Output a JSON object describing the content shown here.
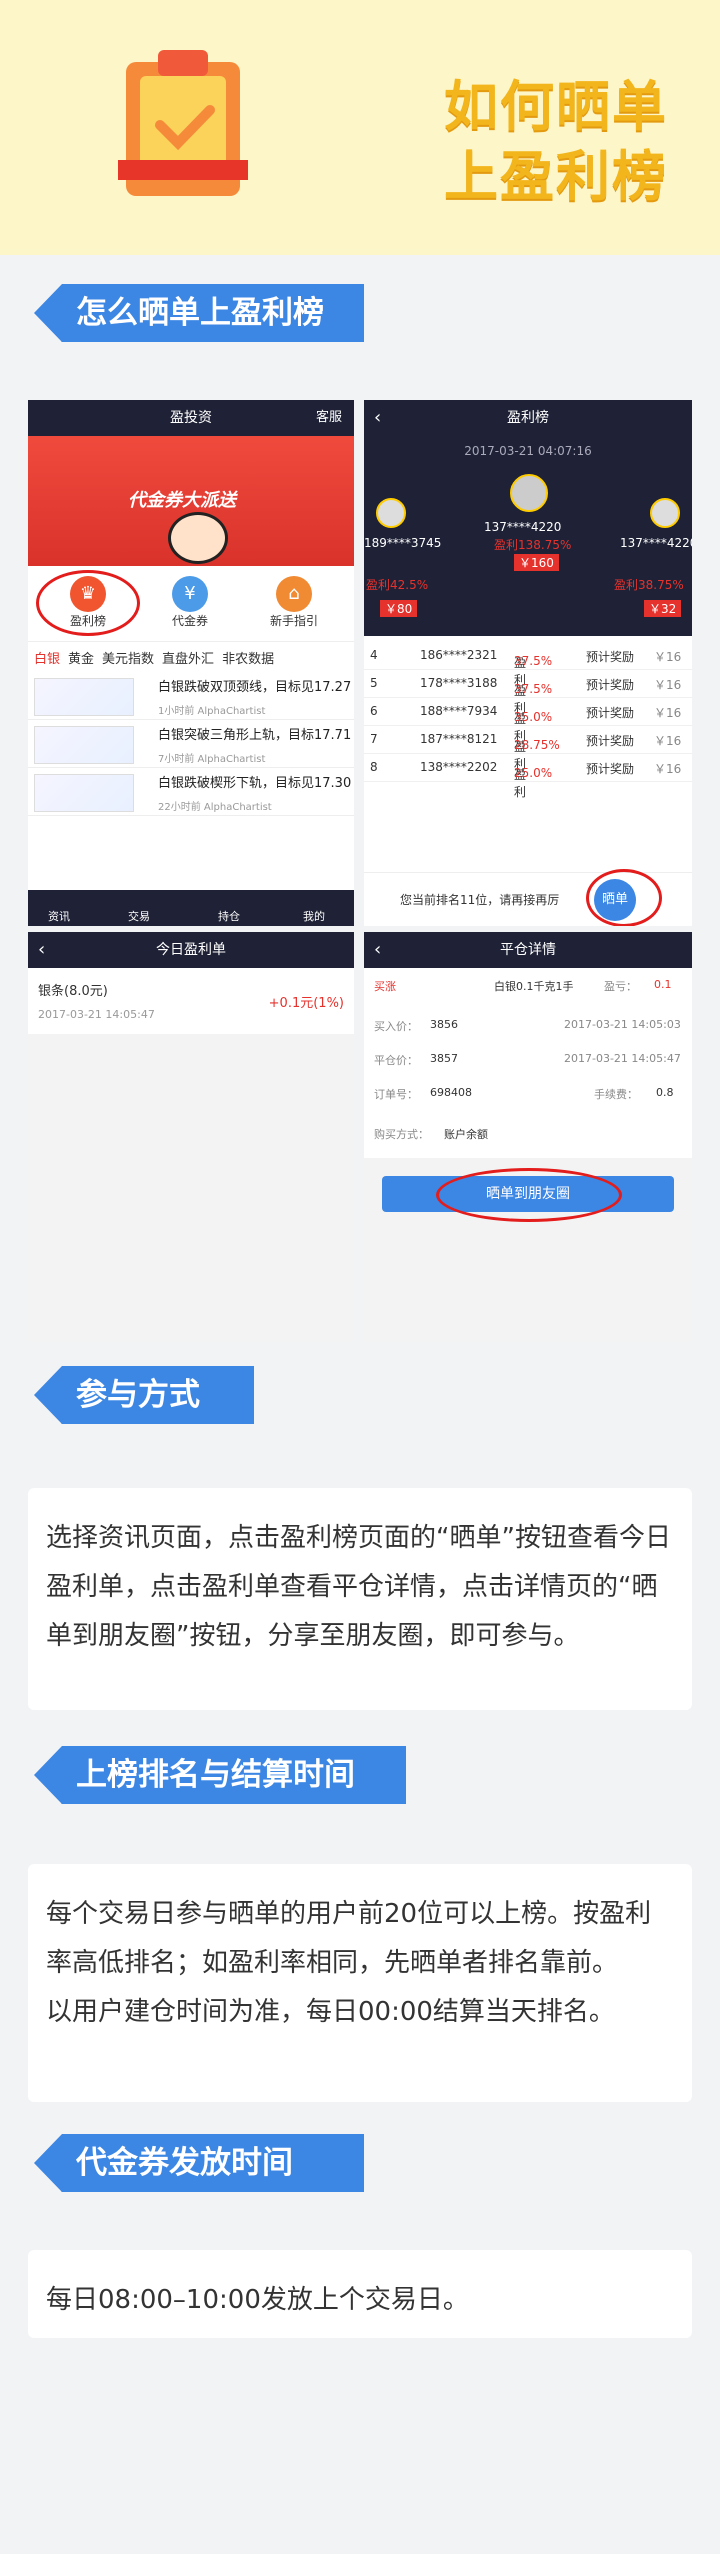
{
  "header": {
    "title_line1": "如何晒单",
    "title_line2": "上盈利榜"
  },
  "sections": {
    "how": "怎么晒单上盈利榜",
    "join": "参与方式",
    "rank": "上榜排名与结算时间",
    "coupon": "代金券发放时间"
  },
  "join_text": "选择资讯页面，点击盈利榜页面的“晒单”按钮查看今日盈利单，点击盈利单查看平仓详情，点击详情页的“晒单到朋友圈”按钮，分享至朋友圈，即可参与。",
  "rank_text1": "每个交易日参与晒单的用户前20位可以上榜。按盈利率高低排名；如盈利率相同，先晒单者排名靠前。",
  "rank_text2": "以用户建仓时间为准，每日00:00结算当天排名。",
  "coupon_text": "每日08:00–10:00发放上个交易日。",
  "s1": {
    "title": "盈投资",
    "right": "客服",
    "banner": "代金券大派送",
    "icons": [
      "盈利榜",
      "代金券",
      "新手指引"
    ],
    "tabs": [
      "白银",
      "黄金",
      "美元指数",
      "直盘外汇",
      "非农数据"
    ],
    "news": [
      {
        "t": "白银跌破双顶颈线，目标见17.27",
        "m": "1小时前  AlphaChartist"
      },
      {
        "t": "白银突破三角形上轨，目标17.71",
        "m": "7小时前  AlphaChartist"
      },
      {
        "t": "白银跌破楔形下轨，目标见17.30",
        "m": "22小时前  AlphaChartist"
      }
    ],
    "nav": [
      "资讯",
      "交易",
      "持仓",
      "我的"
    ]
  },
  "s2": {
    "title": "盈利榜",
    "date": "2017-03-21 04:07:16",
    "top": [
      {
        "u": "189****3745",
        "p": "盈利42.5%",
        "v": "￥80"
      },
      {
        "u": "137****4220",
        "p": "盈利138.75%",
        "v": "￥160"
      },
      {
        "u": "137****4220",
        "p": "盈利38.75%",
        "v": "￥32"
      }
    ],
    "rows": [
      {
        "n": "4",
        "u": "186****2321",
        "p": "37.5%"
      },
      {
        "n": "5",
        "u": "178****3188",
        "p": "37.5%"
      },
      {
        "n": "6",
        "u": "188****7934",
        "p": "35.0%"
      },
      {
        "n": "7",
        "u": "187****8121",
        "p": "28.75%"
      },
      {
        "n": "8",
        "u": "138****2202",
        "p": "25.0%"
      }
    ],
    "reward": "预计奖励",
    "rv": "￥16",
    "lb": "盈利",
    "mine": "您当前排名11位，请再接再厉",
    "btn": "晒单"
  },
  "s3": {
    "title": "今日盈利单",
    "item": "银条(8.0元)",
    "date": "2017-03-21 14:05:47",
    "profit": "+0.1元(1%)"
  },
  "s4": {
    "title": "平仓详情",
    "side": "买涨",
    "prod": "白银0.1千克1手",
    "pl": "盈亏：",
    "plv": "0.1",
    "r1": [
      "买入价：",
      "3856",
      "2017-03-21 14:05:03"
    ],
    "r2": [
      "平仓价：",
      "3857",
      "2017-03-21 14:05:47"
    ],
    "r3": [
      "订单号：",
      "698408",
      "手续费：",
      "0.8"
    ],
    "r4": [
      "购买方式：",
      "账户余额"
    ],
    "btn": "晒单到朋友圈"
  }
}
